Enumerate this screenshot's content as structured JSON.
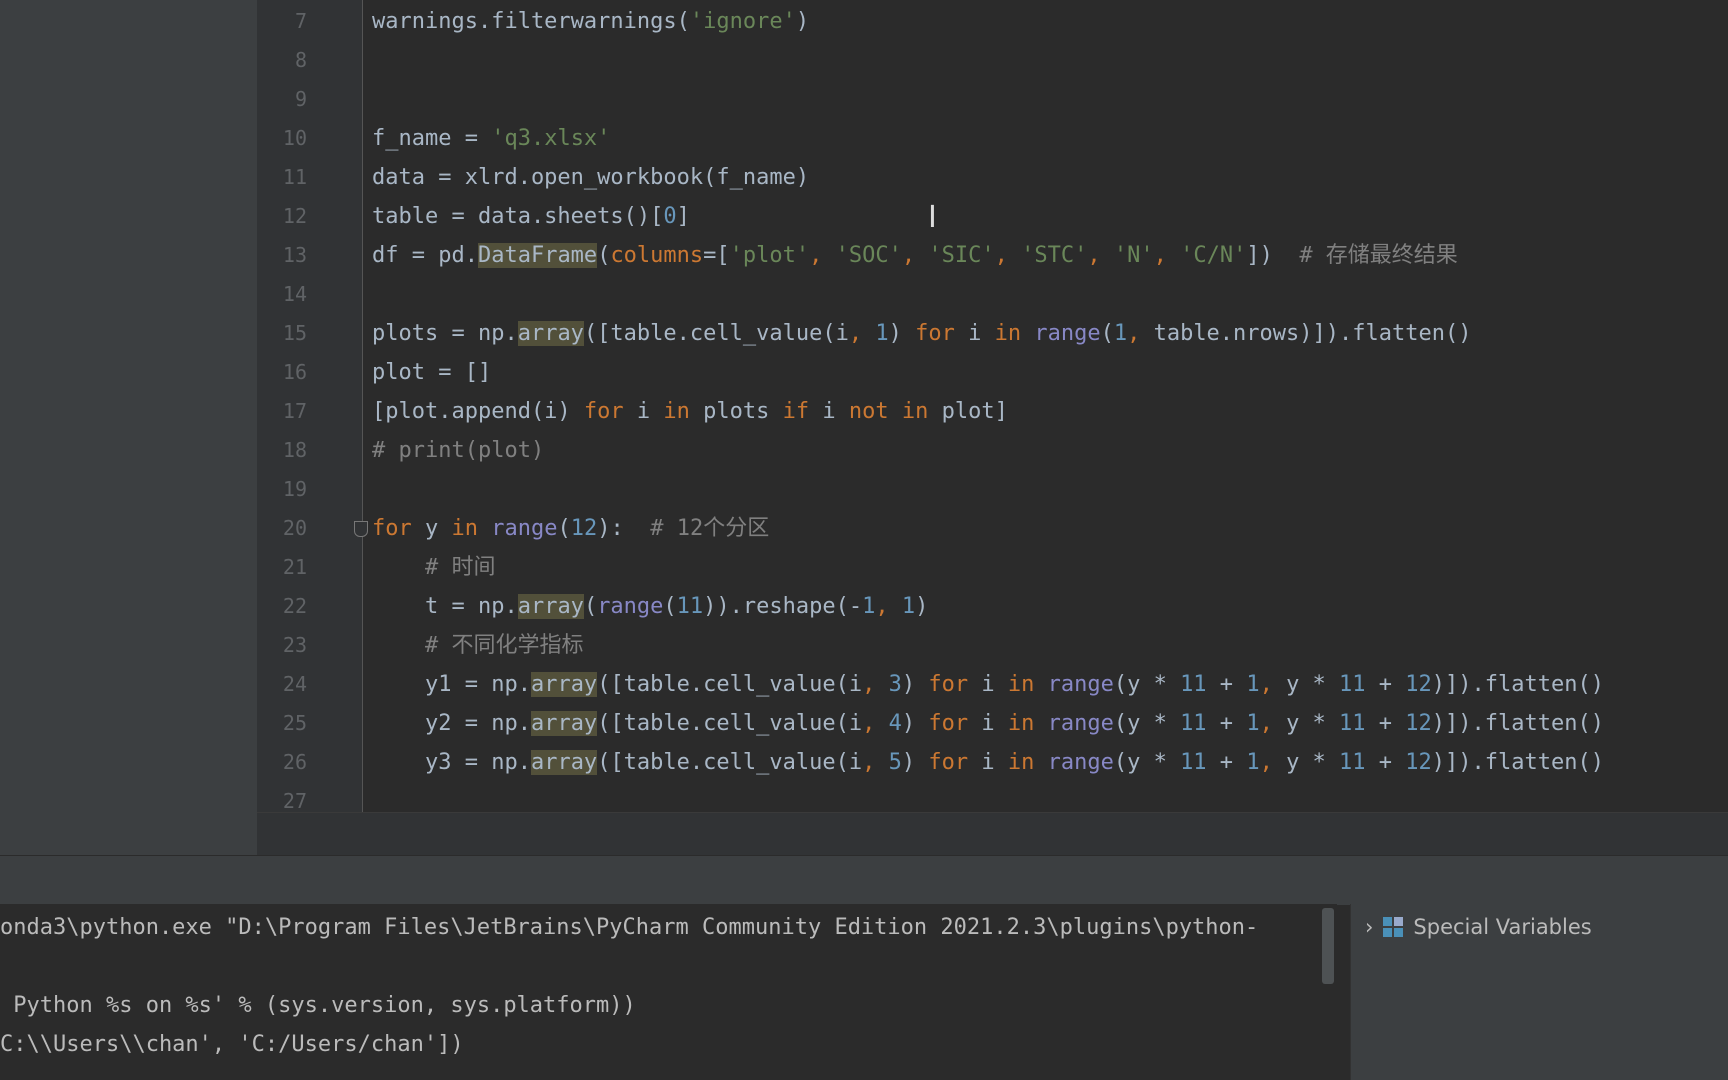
{
  "editor": {
    "lines": [
      {
        "n": "7",
        "seg": [
          [
            "",
            "warnings.filterwarnings("
          ],
          [
            "str",
            "'ignore'"
          ],
          [
            "",
            ")"
          ]
        ]
      },
      {
        "n": "8",
        "seg": []
      },
      {
        "n": "9",
        "seg": []
      },
      {
        "n": "10",
        "seg": [
          [
            "",
            "f_name = "
          ],
          [
            "str",
            "'q3.xlsx'"
          ]
        ]
      },
      {
        "n": "11",
        "seg": [
          [
            "",
            "data = xlrd.open_workbook(f_name)"
          ]
        ]
      },
      {
        "n": "12",
        "seg": [
          [
            "",
            "table = data.sheets()["
          ],
          [
            "num",
            "0"
          ],
          [
            "",
            "]"
          ]
        ]
      },
      {
        "n": "13",
        "seg": [
          [
            "",
            "df = pd."
          ],
          [
            "hl",
            "DataFrame"
          ],
          [
            "",
            "("
          ],
          [
            "param",
            "columns"
          ],
          [
            "",
            "=["
          ],
          [
            "str",
            "'plot'"
          ],
          [
            "kw",
            ", "
          ],
          [
            "str",
            "'SOC'"
          ],
          [
            "kw",
            ", "
          ],
          [
            "str",
            "'SIC'"
          ],
          [
            "kw",
            ", "
          ],
          [
            "str",
            "'STC'"
          ],
          [
            "kw",
            ", "
          ],
          [
            "str",
            "'N'"
          ],
          [
            "kw",
            ", "
          ],
          [
            "str",
            "'C/N'"
          ],
          [
            "",
            "])  "
          ],
          [
            "cm",
            "# 存储最终结果"
          ]
        ]
      },
      {
        "n": "14",
        "seg": []
      },
      {
        "n": "15",
        "seg": [
          [
            "",
            "plots = np."
          ],
          [
            "hl",
            "array"
          ],
          [
            "",
            "([table.cell_value(i"
          ],
          [
            "kw",
            ", "
          ],
          [
            "num",
            "1"
          ],
          [
            "",
            ") "
          ],
          [
            "kw",
            "for"
          ],
          [
            "",
            " i "
          ],
          [
            "kw",
            "in"
          ],
          [
            "",
            " "
          ],
          [
            "bi",
            "range"
          ],
          [
            "",
            "("
          ],
          [
            "num",
            "1"
          ],
          [
            "kw",
            ", "
          ],
          [
            "",
            "table.nrows)]).flatten()"
          ]
        ]
      },
      {
        "n": "16",
        "seg": [
          [
            "",
            "plot = []"
          ]
        ]
      },
      {
        "n": "17",
        "seg": [
          [
            "",
            "[plot.append(i) "
          ],
          [
            "kw",
            "for"
          ],
          [
            "",
            " i "
          ],
          [
            "kw",
            "in"
          ],
          [
            "",
            " plots "
          ],
          [
            "kw",
            "if"
          ],
          [
            "",
            " i "
          ],
          [
            "kw",
            "not in"
          ],
          [
            "",
            " plot]"
          ]
        ]
      },
      {
        "n": "18",
        "seg": [
          [
            "cm",
            "# print(plot)"
          ]
        ]
      },
      {
        "n": "19",
        "seg": []
      },
      {
        "n": "20",
        "seg": [
          [
            "kw",
            "for"
          ],
          [
            "",
            " y "
          ],
          [
            "kw",
            "in"
          ],
          [
            "",
            " "
          ],
          [
            "bi",
            "range"
          ],
          [
            "",
            "("
          ],
          [
            "num",
            "12"
          ],
          [
            "",
            "):  "
          ],
          [
            "cm",
            "# 12个分区"
          ]
        ]
      },
      {
        "n": "21",
        "seg": [
          [
            "",
            "    "
          ],
          [
            "cm",
            "# 时间"
          ]
        ]
      },
      {
        "n": "22",
        "seg": [
          [
            "",
            "    t = np."
          ],
          [
            "hl",
            "array"
          ],
          [
            "",
            "("
          ],
          [
            "bi",
            "range"
          ],
          [
            "",
            "("
          ],
          [
            "num",
            "11"
          ],
          [
            "",
            ")).reshape(-"
          ],
          [
            "num",
            "1"
          ],
          [
            "kw",
            ", "
          ],
          [
            "num",
            "1"
          ],
          [
            "",
            ")"
          ]
        ]
      },
      {
        "n": "23",
        "seg": [
          [
            "",
            "    "
          ],
          [
            "cm",
            "# 不同化学指标"
          ]
        ]
      },
      {
        "n": "24",
        "seg": [
          [
            "",
            "    y1 = np."
          ],
          [
            "hl",
            "array"
          ],
          [
            "",
            "([table.cell_value(i"
          ],
          [
            "kw",
            ", "
          ],
          [
            "num",
            "3"
          ],
          [
            "",
            ") "
          ],
          [
            "kw",
            "for"
          ],
          [
            "",
            " i "
          ],
          [
            "kw",
            "in"
          ],
          [
            "",
            " "
          ],
          [
            "bi",
            "range"
          ],
          [
            "",
            "(y * "
          ],
          [
            "num",
            "11"
          ],
          [
            "",
            " + "
          ],
          [
            "num",
            "1"
          ],
          [
            "kw",
            ", "
          ],
          [
            "",
            "y * "
          ],
          [
            "num",
            "11"
          ],
          [
            "",
            " + "
          ],
          [
            "num",
            "12"
          ],
          [
            "",
            ")]).flatten()"
          ]
        ]
      },
      {
        "n": "25",
        "seg": [
          [
            "",
            "    y2 = np."
          ],
          [
            "hl",
            "array"
          ],
          [
            "",
            "([table.cell_value(i"
          ],
          [
            "kw",
            ", "
          ],
          [
            "num",
            "4"
          ],
          [
            "",
            ") "
          ],
          [
            "kw",
            "for"
          ],
          [
            "",
            " i "
          ],
          [
            "kw",
            "in"
          ],
          [
            "",
            " "
          ],
          [
            "bi",
            "range"
          ],
          [
            "",
            "(y * "
          ],
          [
            "num",
            "11"
          ],
          [
            "",
            " + "
          ],
          [
            "num",
            "1"
          ],
          [
            "kw",
            ", "
          ],
          [
            "",
            "y * "
          ],
          [
            "num",
            "11"
          ],
          [
            "",
            " + "
          ],
          [
            "num",
            "12"
          ],
          [
            "",
            ")]).flatten()"
          ]
        ]
      },
      {
        "n": "26",
        "seg": [
          [
            "",
            "    y3 = np."
          ],
          [
            "hl",
            "array"
          ],
          [
            "",
            "([table.cell_value(i"
          ],
          [
            "kw",
            ", "
          ],
          [
            "num",
            "5"
          ],
          [
            "",
            ") "
          ],
          [
            "kw",
            "for"
          ],
          [
            "",
            " i "
          ],
          [
            "kw",
            "in"
          ],
          [
            "",
            " "
          ],
          [
            "bi",
            "range"
          ],
          [
            "",
            "(y * "
          ],
          [
            "num",
            "11"
          ],
          [
            "",
            " + "
          ],
          [
            "num",
            "1"
          ],
          [
            "kw",
            ", "
          ],
          [
            "",
            "y * "
          ],
          [
            "num",
            "11"
          ],
          [
            "",
            " + "
          ],
          [
            "num",
            "12"
          ],
          [
            "",
            ")]).flatten()"
          ]
        ]
      },
      {
        "n": "27",
        "seg": []
      }
    ]
  },
  "console": {
    "lines": [
      "onda3\\python.exe \"D:\\Program Files\\JetBrains\\PyCharm Community Edition 2021.2.3\\plugins\\python-",
      "",
      " Python %s on %s' % (sys.version, sys.platform))",
      "C:\\\\Users\\\\chan', 'C:/Users/chan'])"
    ]
  },
  "variables": {
    "special_label": "Special Variables"
  },
  "colors": {
    "keyword": "#cc7832",
    "number": "#6897bb",
    "string": "#6a8759",
    "comment": "#808080",
    "builtin": "#8888c6",
    "background": "#2b2b2b"
  },
  "icons": {
    "cursor": "text-cursor-icon",
    "expand": "chevron-right-icon",
    "variables": "grid-icon"
  }
}
